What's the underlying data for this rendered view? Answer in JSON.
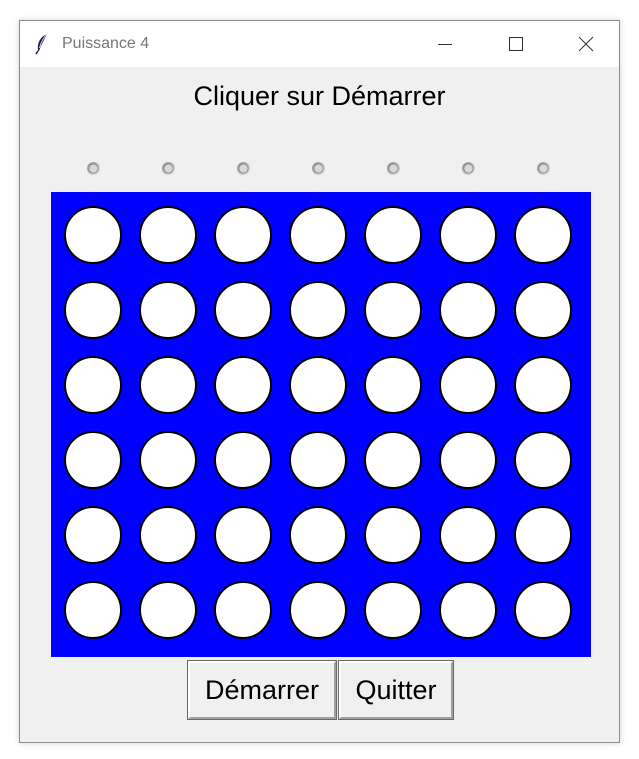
{
  "window": {
    "title": "Puissance 4",
    "icon": "feather-icon",
    "controls": [
      "minimize-icon",
      "maximize-icon",
      "close-icon"
    ]
  },
  "status": {
    "message": "Cliquer sur Démarrer"
  },
  "board": {
    "columns": 7,
    "rows": 6,
    "background_color": "#0000ff",
    "empty_cell_color": "#ffffff",
    "cells": [
      [
        "empty",
        "empty",
        "empty",
        "empty",
        "empty",
        "empty",
        "empty"
      ],
      [
        "empty",
        "empty",
        "empty",
        "empty",
        "empty",
        "empty",
        "empty"
      ],
      [
        "empty",
        "empty",
        "empty",
        "empty",
        "empty",
        "empty",
        "empty"
      ],
      [
        "empty",
        "empty",
        "empty",
        "empty",
        "empty",
        "empty",
        "empty"
      ],
      [
        "empty",
        "empty",
        "empty",
        "empty",
        "empty",
        "empty",
        "empty"
      ],
      [
        "empty",
        "empty",
        "empty",
        "empty",
        "empty",
        "empty",
        "empty"
      ]
    ]
  },
  "column_selectors": {
    "count": 7,
    "selected": null
  },
  "buttons": {
    "start_label": "Démarrer",
    "quit_label": "Quitter"
  }
}
